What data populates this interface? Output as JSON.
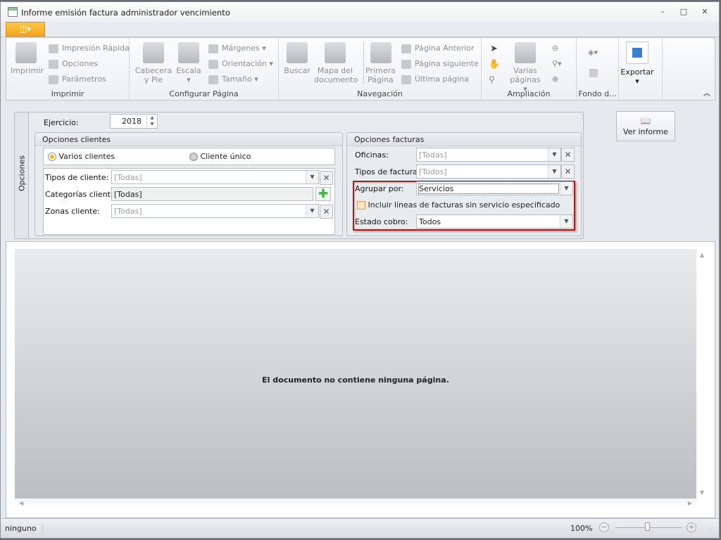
{
  "window": {
    "title": "Informe emisión factura administrador vencimiento",
    "controls": {
      "minimize": "–",
      "maximize": "□",
      "close": "✕"
    }
  },
  "menu": {
    "app_button_icon": "◫▾"
  },
  "ribbon": {
    "groups": [
      {
        "label": "Imprimir",
        "big": [
          "Imprimir"
        ],
        "small": [
          "Impresión Rápida",
          "Opciones",
          "Parámetros"
        ]
      },
      {
        "label": "Configurar Página",
        "big": [
          "Cabecera y Pie",
          "Escala"
        ],
        "small": [
          "Márgenes ▾",
          "Orientación ▾",
          "Tamaño ▾"
        ]
      },
      {
        "label": "Navegación",
        "big": [
          "Buscar",
          "Mapa del documento",
          "Primera Página"
        ],
        "small": [
          "Página Anterior",
          "Página siguiente",
          "Última página"
        ]
      },
      {
        "label": "Ampliación",
        "big": [
          "Varias páginas ▾"
        ]
      },
      {
        "label": "Fondo d..."
      },
      {
        "label": "",
        "big": [
          "Exportar"
        ]
      }
    ],
    "collapse_icon": "︽"
  },
  "options": {
    "tab_label": "Opciones",
    "ejercicio_label": "Ejercicio:",
    "ejercicio_value": "2018",
    "clientes": {
      "title": "Opciones clientes",
      "radio_multi": "Varios clientes",
      "radio_single": "Cliente único",
      "selected": "Varios clientes",
      "tipos_label": "Tipos de cliente:",
      "tipos_value": "[Todas]",
      "categorias_label": "Categorías cliente:",
      "categorias_value": "[Todas]",
      "zonas_label": "Zonas cliente:",
      "zonas_value": "[Todas]"
    },
    "facturas": {
      "title": "Opciones facturas",
      "oficinas_label": "Oficinas:",
      "oficinas_value": "[Todas]",
      "tipos_label": "Tipos de factura:",
      "tipos_value": "[Todos]",
      "agrupar_label": "Agrupar por:",
      "agrupar_value": "Servicios",
      "incluir_label": "Incluir líneas de facturas sin servicio especificado",
      "incluir_checked": false,
      "estado_label": "Estado cobro:",
      "estado_value": "Todos"
    },
    "ver_informe": "Ver informe"
  },
  "preview": {
    "empty_message": "El documento no contiene ninguna página."
  },
  "status": {
    "left": "ninguno",
    "zoom": "100%",
    "zoom_level_percent": 100
  },
  "colors": {
    "accent": "#f6a31a",
    "highlight": "#e00000"
  }
}
